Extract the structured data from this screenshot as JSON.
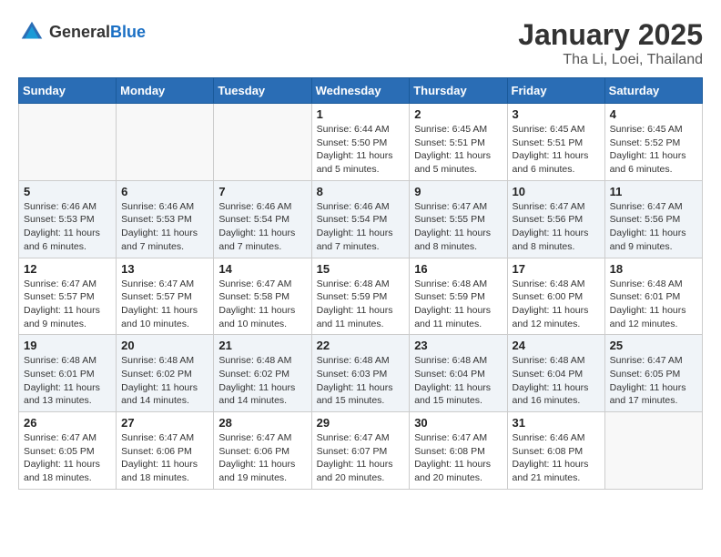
{
  "header": {
    "logo_general": "General",
    "logo_blue": "Blue",
    "month": "January 2025",
    "location": "Tha Li, Loei, Thailand"
  },
  "days_of_week": [
    "Sunday",
    "Monday",
    "Tuesday",
    "Wednesday",
    "Thursday",
    "Friday",
    "Saturday"
  ],
  "weeks": [
    {
      "days": [
        {
          "number": "",
          "sunrise": "",
          "sunset": "",
          "daylight": "",
          "empty": true
        },
        {
          "number": "",
          "sunrise": "",
          "sunset": "",
          "daylight": "",
          "empty": true
        },
        {
          "number": "",
          "sunrise": "",
          "sunset": "",
          "daylight": "",
          "empty": true
        },
        {
          "number": "1",
          "sunrise": "Sunrise: 6:44 AM",
          "sunset": "Sunset: 5:50 PM",
          "daylight": "Daylight: 11 hours and 5 minutes."
        },
        {
          "number": "2",
          "sunrise": "Sunrise: 6:45 AM",
          "sunset": "Sunset: 5:51 PM",
          "daylight": "Daylight: 11 hours and 5 minutes."
        },
        {
          "number": "3",
          "sunrise": "Sunrise: 6:45 AM",
          "sunset": "Sunset: 5:51 PM",
          "daylight": "Daylight: 11 hours and 6 minutes."
        },
        {
          "number": "4",
          "sunrise": "Sunrise: 6:45 AM",
          "sunset": "Sunset: 5:52 PM",
          "daylight": "Daylight: 11 hours and 6 minutes."
        }
      ]
    },
    {
      "days": [
        {
          "number": "5",
          "sunrise": "Sunrise: 6:46 AM",
          "sunset": "Sunset: 5:53 PM",
          "daylight": "Daylight: 11 hours and 6 minutes."
        },
        {
          "number": "6",
          "sunrise": "Sunrise: 6:46 AM",
          "sunset": "Sunset: 5:53 PM",
          "daylight": "Daylight: 11 hours and 7 minutes."
        },
        {
          "number": "7",
          "sunrise": "Sunrise: 6:46 AM",
          "sunset": "Sunset: 5:54 PM",
          "daylight": "Daylight: 11 hours and 7 minutes."
        },
        {
          "number": "8",
          "sunrise": "Sunrise: 6:46 AM",
          "sunset": "Sunset: 5:54 PM",
          "daylight": "Daylight: 11 hours and 7 minutes."
        },
        {
          "number": "9",
          "sunrise": "Sunrise: 6:47 AM",
          "sunset": "Sunset: 5:55 PM",
          "daylight": "Daylight: 11 hours and 8 minutes."
        },
        {
          "number": "10",
          "sunrise": "Sunrise: 6:47 AM",
          "sunset": "Sunset: 5:56 PM",
          "daylight": "Daylight: 11 hours and 8 minutes."
        },
        {
          "number": "11",
          "sunrise": "Sunrise: 6:47 AM",
          "sunset": "Sunset: 5:56 PM",
          "daylight": "Daylight: 11 hours and 9 minutes."
        }
      ]
    },
    {
      "days": [
        {
          "number": "12",
          "sunrise": "Sunrise: 6:47 AM",
          "sunset": "Sunset: 5:57 PM",
          "daylight": "Daylight: 11 hours and 9 minutes."
        },
        {
          "number": "13",
          "sunrise": "Sunrise: 6:47 AM",
          "sunset": "Sunset: 5:57 PM",
          "daylight": "Daylight: 11 hours and 10 minutes."
        },
        {
          "number": "14",
          "sunrise": "Sunrise: 6:47 AM",
          "sunset": "Sunset: 5:58 PM",
          "daylight": "Daylight: 11 hours and 10 minutes."
        },
        {
          "number": "15",
          "sunrise": "Sunrise: 6:48 AM",
          "sunset": "Sunset: 5:59 PM",
          "daylight": "Daylight: 11 hours and 11 minutes."
        },
        {
          "number": "16",
          "sunrise": "Sunrise: 6:48 AM",
          "sunset": "Sunset: 5:59 PM",
          "daylight": "Daylight: 11 hours and 11 minutes."
        },
        {
          "number": "17",
          "sunrise": "Sunrise: 6:48 AM",
          "sunset": "Sunset: 6:00 PM",
          "daylight": "Daylight: 11 hours and 12 minutes."
        },
        {
          "number": "18",
          "sunrise": "Sunrise: 6:48 AM",
          "sunset": "Sunset: 6:01 PM",
          "daylight": "Daylight: 11 hours and 12 minutes."
        }
      ]
    },
    {
      "days": [
        {
          "number": "19",
          "sunrise": "Sunrise: 6:48 AM",
          "sunset": "Sunset: 6:01 PM",
          "daylight": "Daylight: 11 hours and 13 minutes."
        },
        {
          "number": "20",
          "sunrise": "Sunrise: 6:48 AM",
          "sunset": "Sunset: 6:02 PM",
          "daylight": "Daylight: 11 hours and 14 minutes."
        },
        {
          "number": "21",
          "sunrise": "Sunrise: 6:48 AM",
          "sunset": "Sunset: 6:02 PM",
          "daylight": "Daylight: 11 hours and 14 minutes."
        },
        {
          "number": "22",
          "sunrise": "Sunrise: 6:48 AM",
          "sunset": "Sunset: 6:03 PM",
          "daylight": "Daylight: 11 hours and 15 minutes."
        },
        {
          "number": "23",
          "sunrise": "Sunrise: 6:48 AM",
          "sunset": "Sunset: 6:04 PM",
          "daylight": "Daylight: 11 hours and 15 minutes."
        },
        {
          "number": "24",
          "sunrise": "Sunrise: 6:48 AM",
          "sunset": "Sunset: 6:04 PM",
          "daylight": "Daylight: 11 hours and 16 minutes."
        },
        {
          "number": "25",
          "sunrise": "Sunrise: 6:47 AM",
          "sunset": "Sunset: 6:05 PM",
          "daylight": "Daylight: 11 hours and 17 minutes."
        }
      ]
    },
    {
      "days": [
        {
          "number": "26",
          "sunrise": "Sunrise: 6:47 AM",
          "sunset": "Sunset: 6:05 PM",
          "daylight": "Daylight: 11 hours and 18 minutes."
        },
        {
          "number": "27",
          "sunrise": "Sunrise: 6:47 AM",
          "sunset": "Sunset: 6:06 PM",
          "daylight": "Daylight: 11 hours and 18 minutes."
        },
        {
          "number": "28",
          "sunrise": "Sunrise: 6:47 AM",
          "sunset": "Sunset: 6:06 PM",
          "daylight": "Daylight: 11 hours and 19 minutes."
        },
        {
          "number": "29",
          "sunrise": "Sunrise: 6:47 AM",
          "sunset": "Sunset: 6:07 PM",
          "daylight": "Daylight: 11 hours and 20 minutes."
        },
        {
          "number": "30",
          "sunrise": "Sunrise: 6:47 AM",
          "sunset": "Sunset: 6:08 PM",
          "daylight": "Daylight: 11 hours and 20 minutes."
        },
        {
          "number": "31",
          "sunrise": "Sunrise: 6:46 AM",
          "sunset": "Sunset: 6:08 PM",
          "daylight": "Daylight: 11 hours and 21 minutes."
        },
        {
          "number": "",
          "sunrise": "",
          "sunset": "",
          "daylight": "",
          "empty": true
        }
      ]
    }
  ]
}
